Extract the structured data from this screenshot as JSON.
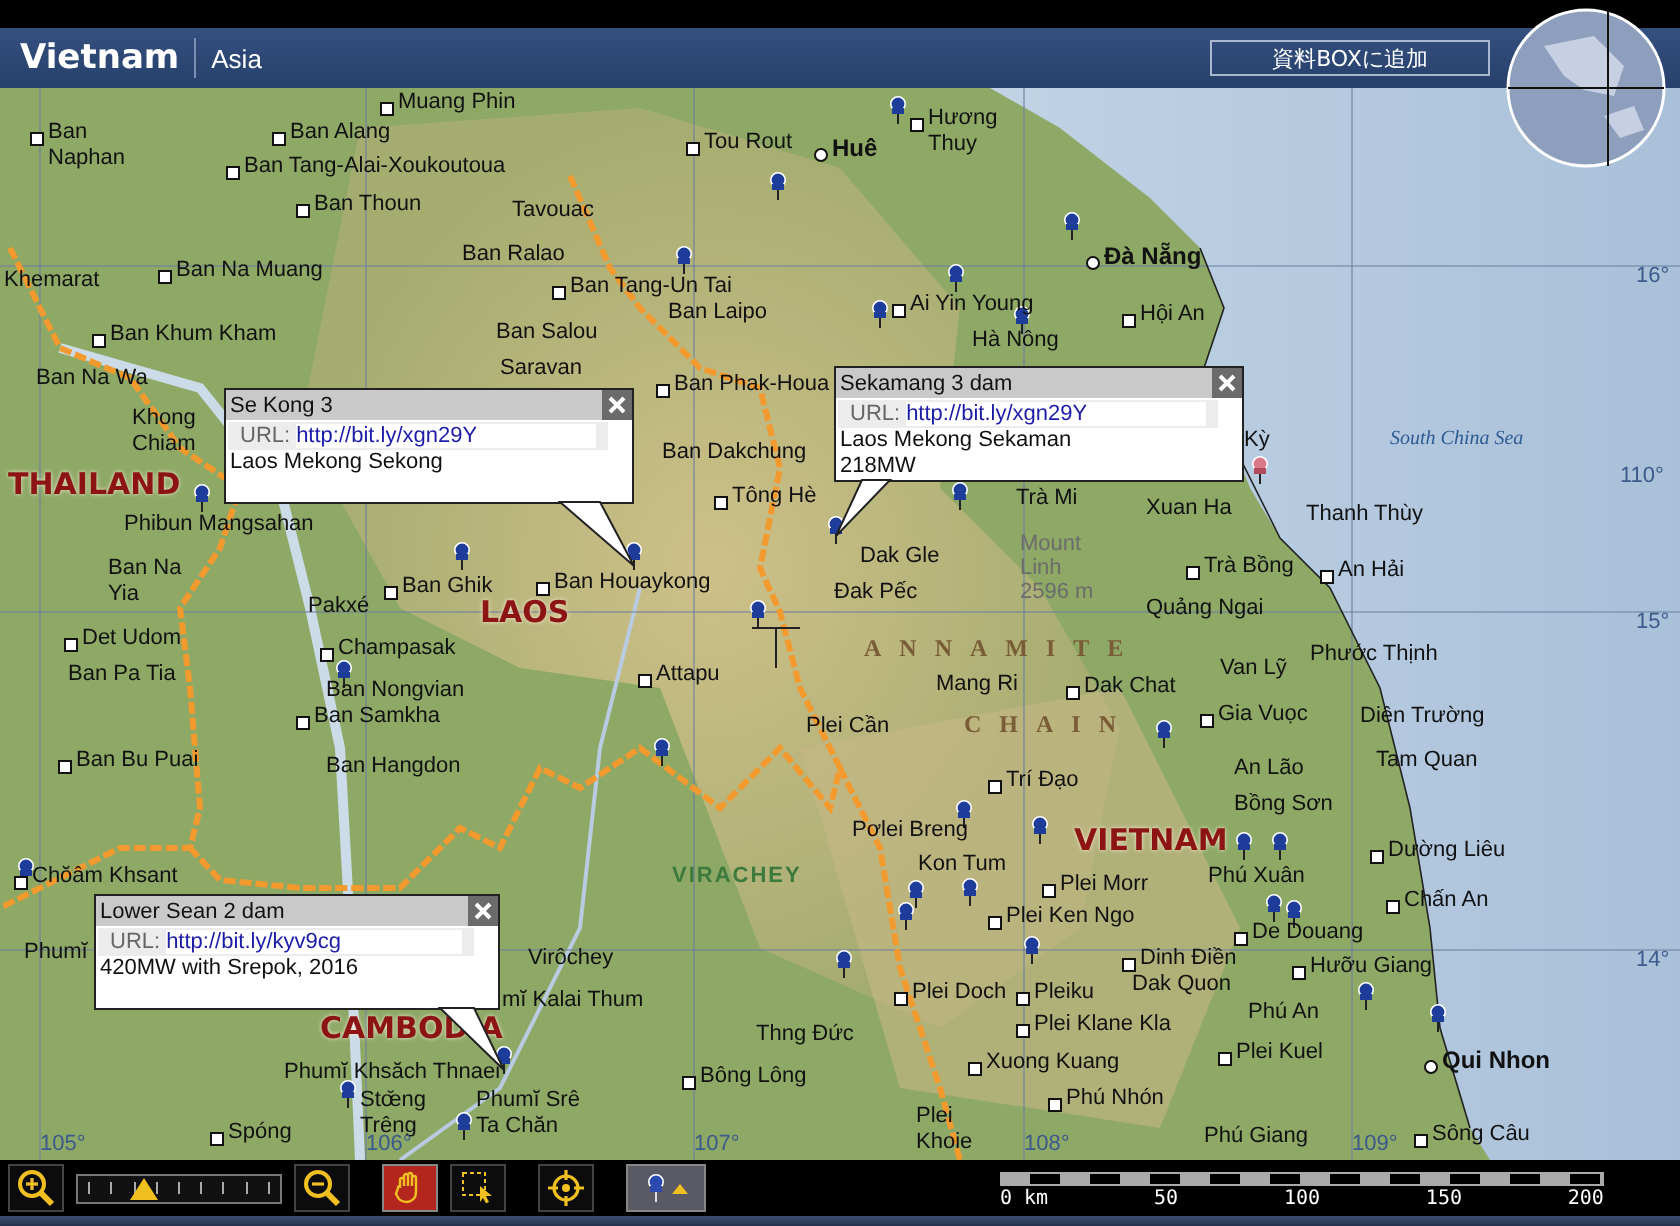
{
  "header": {
    "title": "Vietnam",
    "region": "Asia",
    "add_button": "資料BOXに追加"
  },
  "places": [
    {
      "name": "Muang Phin",
      "kind": "town"
    },
    {
      "name": "Ban Naphan",
      "kind": "town"
    },
    {
      "name": "Ban Alang",
      "kind": "town"
    },
    {
      "name": "Ban Tang-Alai-Xoukoutoua",
      "kind": "town"
    },
    {
      "name": "Ban Thoun",
      "kind": "town"
    },
    {
      "name": "Tou Rout",
      "kind": "town"
    },
    {
      "name": "Huê",
      "kind": "city"
    },
    {
      "name": "Hương Thuy",
      "kind": "town"
    },
    {
      "name": "Tavouac",
      "kind": "label"
    },
    {
      "name": "Ban Ralao",
      "kind": "label"
    },
    {
      "name": "Ban Tang-Un Tai",
      "kind": "town"
    },
    {
      "name": "Ban Laipo",
      "kind": "label"
    },
    {
      "name": "Đà Nẵng",
      "kind": "city"
    },
    {
      "name": "Khemarat",
      "kind": "label"
    },
    {
      "name": "Ban Na Muang",
      "kind": "town"
    },
    {
      "name": "Ban Khum Kham",
      "kind": "town"
    },
    {
      "name": "Ai Yin Young",
      "kind": "town"
    },
    {
      "name": "Hội An",
      "kind": "town"
    },
    {
      "name": "Ban Salou",
      "kind": "label"
    },
    {
      "name": "Hà Nông",
      "kind": "label"
    },
    {
      "name": "Ban Na Wa",
      "kind": "label"
    },
    {
      "name": "Saravan",
      "kind": "label"
    },
    {
      "name": "Ban Phak-Houa",
      "kind": "town"
    },
    {
      "name": "Khong Chiam",
      "kind": "label"
    },
    {
      "name": "THAILAND",
      "kind": "country"
    },
    {
      "name": "Ban Dakchung",
      "kind": "label"
    },
    {
      "name": "Tông Hè",
      "kind": "town"
    },
    {
      "name": "Phibun Mangsahan",
      "kind": "label"
    },
    {
      "name": "Ban Na Yia",
      "kind": "label"
    },
    {
      "name": "Ban Ghik",
      "kind": "town"
    },
    {
      "name": "Ban Houaykong",
      "kind": "town"
    },
    {
      "name": "Pakxé",
      "kind": "label"
    },
    {
      "name": "LAOS",
      "kind": "country"
    },
    {
      "name": "Det Udom",
      "kind": "town"
    },
    {
      "name": "Champasak",
      "kind": "town"
    },
    {
      "name": "Ban Pa Tia",
      "kind": "label"
    },
    {
      "name": "Attapu",
      "kind": "town"
    },
    {
      "name": "Ban Nongvian",
      "kind": "label"
    },
    {
      "name": "Ban Samkha",
      "kind": "town"
    },
    {
      "name": "Ban Bu Puai",
      "kind": "town"
    },
    {
      "name": "Ban Hangdon",
      "kind": "label"
    },
    {
      "name": "Kỳ",
      "kind": "label"
    },
    {
      "name": "Trà Mi",
      "kind": "label"
    },
    {
      "name": "Xuan Ha",
      "kind": "label"
    },
    {
      "name": "Thanh Thùy",
      "kind": "label"
    },
    {
      "name": "South China Sea",
      "kind": "water"
    },
    {
      "name": "Mount Linh 2596 m",
      "kind": "peak"
    },
    {
      "name": "Dak Gle",
      "kind": "label"
    },
    {
      "name": "Trà Bồng",
      "kind": "town"
    },
    {
      "name": "An Hải",
      "kind": "town"
    },
    {
      "name": "Đak Pếc",
      "kind": "label"
    },
    {
      "name": "Quảng Ngai",
      "kind": "label"
    },
    {
      "name": "ANNAMITE",
      "kind": "range"
    },
    {
      "name": "Phước Thịnh",
      "kind": "label"
    },
    {
      "name": "Van Lỹ",
      "kind": "label"
    },
    {
      "name": "Mang Ri",
      "kind": "label"
    },
    {
      "name": "Dak Chat",
      "kind": "town"
    },
    {
      "name": "Plei Cần",
      "kind": "label"
    },
    {
      "name": "CHAIN",
      "kind": "range"
    },
    {
      "name": "Gia Vuọc",
      "kind": "town"
    },
    {
      "name": "Diên Trường",
      "kind": "label"
    },
    {
      "name": "An Lão",
      "kind": "label"
    },
    {
      "name": "Tam Quan",
      "kind": "label"
    },
    {
      "name": "Trí Đạo",
      "kind": "town"
    },
    {
      "name": "Bồng Sơn",
      "kind": "label"
    },
    {
      "name": "Pơlei Breng",
      "kind": "label"
    },
    {
      "name": "VIETNAM",
      "kind": "country"
    },
    {
      "name": "Kon Tum",
      "kind": "label"
    },
    {
      "name": "Dường Liêu",
      "kind": "town"
    },
    {
      "name": "Plei Morr",
      "kind": "town"
    },
    {
      "name": "Phú Xuân",
      "kind": "label"
    },
    {
      "name": "Chấn An",
      "kind": "town"
    },
    {
      "name": "Plei Ken Ngo",
      "kind": "town"
    },
    {
      "name": "De Douang",
      "kind": "town"
    },
    {
      "name": "Dinh Điền",
      "kind": "town"
    },
    {
      "name": "Dak Quon",
      "kind": "label"
    },
    {
      "name": "Hưỡu Giang",
      "kind": "town"
    },
    {
      "name": "Plei Doch",
      "kind": "town"
    },
    {
      "name": "Pleiku",
      "kind": "town"
    },
    {
      "name": "Phú An",
      "kind": "label"
    },
    {
      "name": "Plei Klane Kla",
      "kind": "town"
    },
    {
      "name": "Qui Nhon",
      "kind": "city"
    },
    {
      "name": "Thng Đức",
      "kind": "label"
    },
    {
      "name": "Xuong Kuang",
      "kind": "town"
    },
    {
      "name": "Plei Kuel",
      "kind": "town"
    },
    {
      "name": "Phú Nhón",
      "kind": "town"
    },
    {
      "name": "Plei Khoie",
      "kind": "label"
    },
    {
      "name": "Phú Giang",
      "kind": "label"
    },
    {
      "name": "Sông Câu",
      "kind": "town"
    },
    {
      "name": "Chŏâm Khsant",
      "kind": "town"
    },
    {
      "name": "Phumĭ",
      "kind": "label"
    },
    {
      "name": "VIRACHEY",
      "kind": "park"
    },
    {
      "name": "Virôchey",
      "kind": "label"
    },
    {
      "name": "mĭ Kalai Thum",
      "kind": "label"
    },
    {
      "name": "CAMBODIA",
      "kind": "country"
    },
    {
      "name": "Phumĭ Khsăch Thnaei",
      "kind": "label"
    },
    {
      "name": "Bông Lông",
      "kind": "town"
    },
    {
      "name": "Stœ̆ng Trêng",
      "kind": "label"
    },
    {
      "name": "Phumĭ Srê Ta Chăn",
      "kind": "label"
    },
    {
      "name": "Spóng",
      "kind": "town"
    },
    {
      "name": "16°",
      "kind": "grid"
    },
    {
      "name": "110°",
      "kind": "grid"
    },
    {
      "name": "15°",
      "kind": "grid"
    },
    {
      "name": "14°",
      "kind": "grid"
    },
    {
      "name": "105°",
      "kind": "grid"
    },
    {
      "name": "106°",
      "kind": "grid"
    },
    {
      "name": "107°",
      "kind": "grid"
    },
    {
      "name": "108°",
      "kind": "grid"
    },
    {
      "name": "109°",
      "kind": "grid"
    }
  ],
  "popups": [
    {
      "title": "Se Kong 3",
      "url_label": "URL:",
      "url": "http://bit.ly/xgn29Y",
      "lines": [
        "Laos Mekong Sekong"
      ]
    },
    {
      "title": "Sekamang 3 dam",
      "url_label": "URL:",
      "url": "http://bit.ly/xgn29Y",
      "lines": [
        "Laos Mekong Sekaman",
        "218MW"
      ]
    },
    {
      "title": "Lower Sean 2 dam",
      "url_label": "URL:",
      "url": "http://bit.ly/kyv9cg",
      "lines": [
        "420MW with Srepok, 2016"
      ]
    }
  ],
  "toolbar": {
    "zoom": {
      "level": 0.3
    },
    "tools": [
      {
        "kind": "zoom-in",
        "selected": false
      },
      {
        "kind": "zoom-out",
        "selected": false
      },
      {
        "kind": "pan",
        "selected": true
      },
      {
        "kind": "select",
        "selected": false
      },
      {
        "kind": "locate",
        "selected": false
      },
      {
        "kind": "pin",
        "selected": true
      }
    ]
  },
  "scale": {
    "ticks": [
      "0 km",
      "50",
      "100",
      "150",
      "200"
    ]
  }
}
